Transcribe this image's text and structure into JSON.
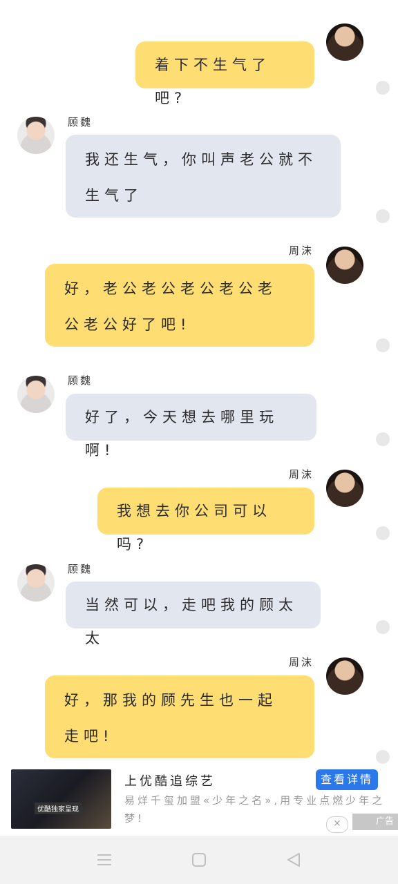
{
  "chat": {
    "messages": [
      {
        "side": "right",
        "sender": "",
        "text": "着下不生气了吧?"
      },
      {
        "side": "left",
        "sender": "顾魏",
        "text": "我还生气，你叫声老公就不生气了"
      },
      {
        "side": "right",
        "sender": "周沫",
        "text": "好，老公老公老公老公老公老公好了吧!"
      },
      {
        "side": "left",
        "sender": "顾魏",
        "text": "好了，今天想去哪里玩啊!"
      },
      {
        "side": "right",
        "sender": "周沫",
        "text": "我想去你公司可以吗?"
      },
      {
        "side": "left",
        "sender": "顾魏",
        "text": "当然可以，走吧我的顾太太"
      },
      {
        "side": "right",
        "sender": "周沫",
        "text": "好，那我的顾先生也一起走吧!"
      }
    ]
  },
  "ad": {
    "title": "上优酷追综艺",
    "description": "易烊千玺加盟«少年之名»,用专业点燃少年之梦!",
    "button_label": "查看详情",
    "close_label": "×",
    "ad_label": "广告",
    "thumb_tag": "优酷独家呈现"
  },
  "icons": {
    "menu": "menu-icon",
    "home": "home-icon",
    "back": "back-icon"
  },
  "colors": {
    "right_bubble": "#fedd73",
    "left_bubble": "#e2e6ef",
    "ad_button": "#2a78ea"
  }
}
